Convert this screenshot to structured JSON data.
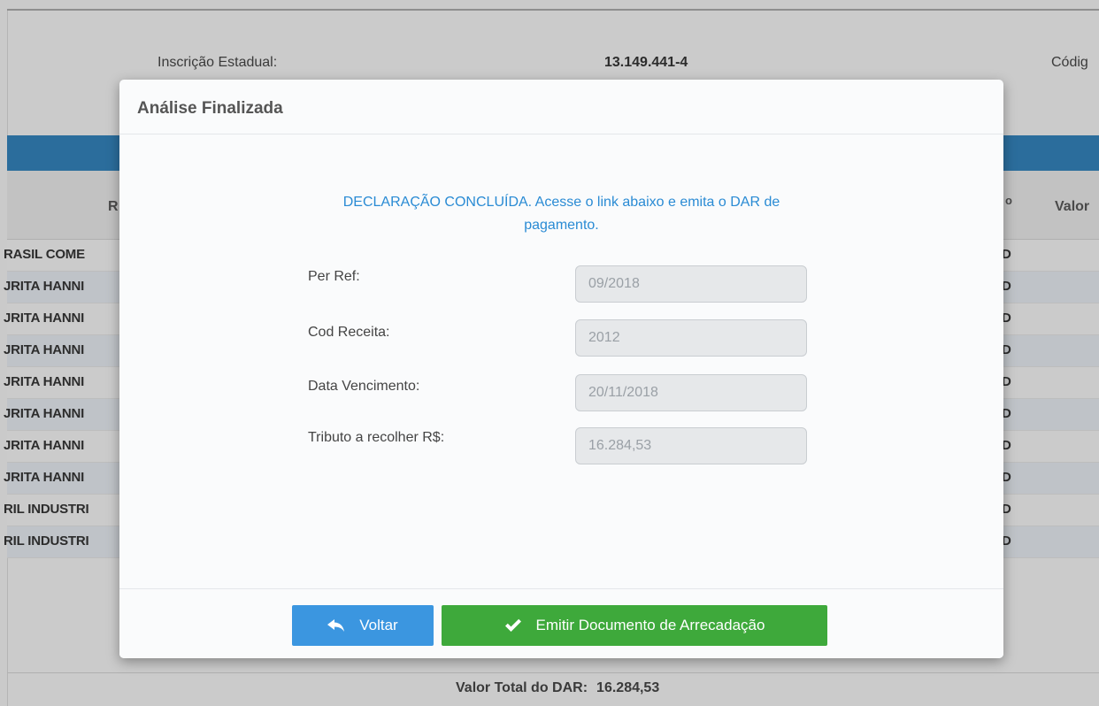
{
  "background": {
    "inscricao_label": "Inscrição Estadual:",
    "inscricao_value": "13.149.441-4",
    "codigo_label_partial": "Códig",
    "col_head_r": "R",
    "col_head_o": "o",
    "col_head_valor": "Valor",
    "rows": [
      {
        "left": "RASIL COME",
        "right": "D"
      },
      {
        "left": "JRITA HANNI",
        "right": "D"
      },
      {
        "left": "JRITA HANNI",
        "right": "D"
      },
      {
        "left": "JRITA HANNI",
        "right": "D"
      },
      {
        "left": "JRITA HANNI",
        "right": "D"
      },
      {
        "left": "JRITA HANNI",
        "right": "D"
      },
      {
        "left": "JRITA HANNI",
        "right": "D"
      },
      {
        "left": "JRITA HANNI",
        "right": "D"
      },
      {
        "left": "RIL INDUSTRI",
        "right": "D"
      },
      {
        "left": "RIL INDUSTRI",
        "right": "D"
      }
    ],
    "total_label": "Valor Total do DAR:",
    "total_value": "16.284,53"
  },
  "modal": {
    "title": "Análise Finalizada",
    "message_line1": "DECLARAÇÃO CONCLUÍDA. Acesse o link abaixo e emita o DAR de",
    "message_line2": "pagamento.",
    "fields": {
      "per_ref": {
        "label": "Per Ref:",
        "value": "09/2018"
      },
      "cod_receita": {
        "label": "Cod Receita:",
        "value": "2012"
      },
      "data_vencimento": {
        "label": "Data Vencimento:",
        "value": "20/11/2018"
      },
      "tributo": {
        "label": "Tributo a recolher R$:",
        "value": "16.284,53"
      }
    },
    "buttons": {
      "back_label": "Voltar",
      "back_icon": "reply-arrow-icon",
      "emit_label": "Emitir Documento de Arrecadação",
      "emit_icon": "check-icon"
    }
  },
  "colors": {
    "blue_button": "#3b96e0",
    "green_button": "#3ea93b",
    "message_blue": "#2a8bd4",
    "header_bar_blue": "#2b6d9c"
  }
}
